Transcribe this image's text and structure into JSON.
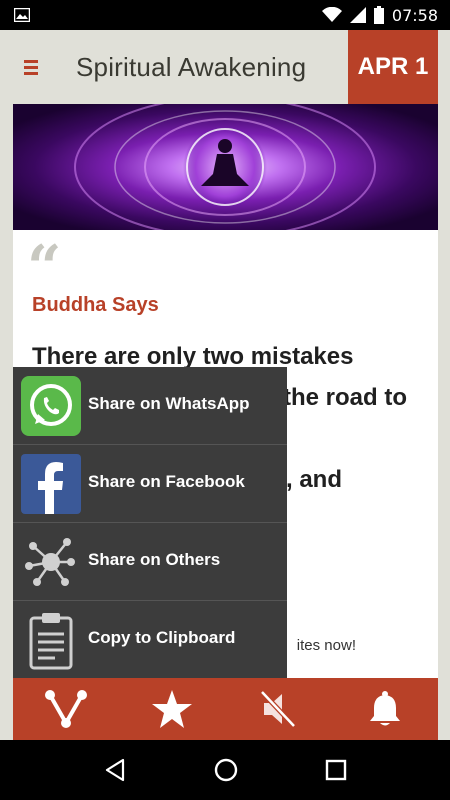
{
  "status_bar": {
    "time": "07:58",
    "icons": [
      "image-icon",
      "wifi-icon",
      "signal-icon",
      "battery-icon"
    ]
  },
  "app_bar": {
    "title": "Spiritual Awakening",
    "date_badge": "APR 1",
    "menu_icon": "hamburger-icon"
  },
  "quote": {
    "author": "Buddha Says",
    "text": "There are only two mistakes one can make along the road to truth; not going all the way, and not starting.",
    "visible_text_lines": [
      "There are only two mistakes",
      "the road to",
      ", and"
    ],
    "hint": "ites now!"
  },
  "share_menu": {
    "items": [
      {
        "label": "Share on WhatsApp",
        "icon": "whatsapp-icon"
      },
      {
        "label": "Share on Facebook",
        "icon": "facebook-icon"
      },
      {
        "label": "Share on Others",
        "icon": "share-network-icon"
      },
      {
        "label": "Copy to Clipboard",
        "icon": "clipboard-icon"
      }
    ]
  },
  "bottom_bar": {
    "tabs": [
      "share-icon",
      "star-icon",
      "mute-icon",
      "bell-icon"
    ]
  },
  "nav_bar": {
    "buttons": [
      "back-icon",
      "home-icon",
      "recents-icon"
    ]
  },
  "colors": {
    "accent": "#b84128",
    "menu_bg": "#3c3c3c",
    "app_bg": "#e0e0d8"
  }
}
